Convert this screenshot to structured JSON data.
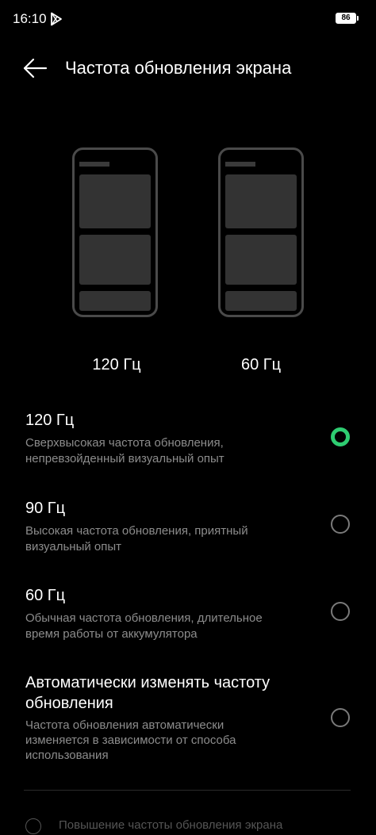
{
  "status_bar": {
    "time": "16:10",
    "battery": "86",
    "play_icon": "play-store-icon"
  },
  "header": {
    "back_icon": "arrow-left-icon",
    "title": "Частота обновления экрана"
  },
  "previews": [
    {
      "label": "120 Гц"
    },
    {
      "label": "60 Гц"
    }
  ],
  "options": [
    {
      "title": "120 Гц",
      "desc_line1": "Сверхвысокая частота обновления,",
      "desc_line2": "непревзойденный визуальный опыт",
      "selected": true
    },
    {
      "title": "90 Гц",
      "desc_line1": "Высокая частота обновления, приятный",
      "desc_line2": "визуальный опыт",
      "selected": false
    },
    {
      "title": "60 Гц",
      "desc_line1": "Обычная частота обновления, длительное",
      "desc_line2": "время работы от аккумулятора",
      "selected": false
    },
    {
      "title_line1": "Автоматически изменять частоту",
      "title_line2": "обновления",
      "desc_line1": "Частота обновления автоматически",
      "desc_line2": "изменяется в зависимости от способа",
      "desc_line3": "использования",
      "selected": false
    }
  ],
  "footer": {
    "info_icon": "info-icon",
    "text": "Повышение частоты обновления экрана"
  },
  "colors": {
    "accent": "#2ecc71",
    "background": "#000000",
    "secondary_text": "#8c8c8c"
  }
}
